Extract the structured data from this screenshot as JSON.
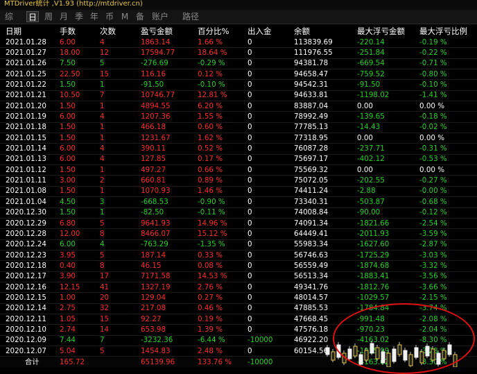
{
  "window": {
    "title": "MTDriver统计 ,V1.93 (http://mtdriver.cn)"
  },
  "tabs": [
    {
      "label": "综",
      "active": false
    },
    {
      "label": "日",
      "active": true
    },
    {
      "label": "周",
      "active": false
    },
    {
      "label": "月",
      "active": false
    },
    {
      "label": "季",
      "active": false
    },
    {
      "label": "年",
      "active": false
    },
    {
      "label": "币",
      "active": false
    },
    {
      "label": "M",
      "active": false
    },
    {
      "label": "备",
      "active": false
    },
    {
      "label": "账户",
      "active": false
    },
    {
      "label": "路径",
      "active": false
    }
  ],
  "table": {
    "headers": [
      "日期",
      "手数",
      "次数",
      "盈亏金额",
      "百分比%",
      "出入金",
      "余额",
      "最大浮亏金额",
      "最大浮亏比例"
    ],
    "rows": [
      [
        "2021.01.28",
        "6.00",
        "4",
        "1863.14",
        "1.66 %",
        "0",
        "113839.69",
        "-220.14",
        "-0.19 %"
      ],
      [
        "2021.01.27",
        "18.00",
        "12",
        "17594.77",
        "18.64 %",
        "0",
        "111976.55",
        "-251.84",
        "-0.22 %"
      ],
      [
        "2021.01.26",
        "7.50",
        "5",
        "-276.69",
        "-0.29 %",
        "0",
        "94381.78",
        "-669.54",
        "-0.71 %"
      ],
      [
        "2021.01.25",
        "22.50",
        "15",
        "116.16",
        "0.12 %",
        "0",
        "94658.47",
        "-759.52",
        "-0.80 %"
      ],
      [
        "2021.01.22",
        "1.50",
        "1",
        "-91.50",
        "-0.10 %",
        "0",
        "94542.31",
        "-91.50",
        "-0.10 %"
      ],
      [
        "2021.01.21",
        "10.50",
        "7",
        "10746.77",
        "12.81 %",
        "0",
        "94633.81",
        "-1198.02",
        "-1.41 %"
      ],
      [
        "2021.01.20",
        "1.50",
        "1",
        "4894.55",
        "6.20 %",
        "0",
        "83887.04",
        "0.00",
        "0.00 %"
      ],
      [
        "2021.01.19",
        "6.00",
        "4",
        "1207.36",
        "1.55 %",
        "0",
        "78992.49",
        "-139.65",
        "-0.18 %"
      ],
      [
        "2021.01.18",
        "1.50",
        "1",
        "466.18",
        "0.60 %",
        "0",
        "77785.13",
        "-14.43",
        "-0.02 %"
      ],
      [
        "2021.01.15",
        "1.50",
        "1",
        "1231.67",
        "1.62 %",
        "0",
        "77318.95",
        "0.00",
        "0.00 %"
      ],
      [
        "2021.01.14",
        "6.00",
        "4",
        "390.11",
        "0.52 %",
        "0",
        "76087.28",
        "-237.71",
        "-0.31 %"
      ],
      [
        "2021.01.13",
        "6.00",
        "4",
        "127.85",
        "0.17 %",
        "0",
        "75697.17",
        "-402.12",
        "-0.53 %"
      ],
      [
        "2021.01.12",
        "1.50",
        "1",
        "497.27",
        "0.66 %",
        "0",
        "75569.32",
        "0.00",
        "0.00 %"
      ],
      [
        "2021.01.11",
        "3.00",
        "2",
        "660.81",
        "0.89 %",
        "0",
        "75072.05",
        "-202.55",
        "-0.27 %"
      ],
      [
        "2021.01.08",
        "1.50",
        "1",
        "1070.93",
        "1.46 %",
        "0",
        "74411.24",
        "-2.88",
        "-0.00 %"
      ],
      [
        "2021.01.04",
        "4.50",
        "3",
        "-668.53",
        "-0.90 %",
        "0",
        "73340.31",
        "-503.87",
        "-0.68 %"
      ],
      [
        "2020.12.30",
        "1.50",
        "1",
        "-82.50",
        "-0.11 %",
        "0",
        "74008.84",
        "-90.00",
        "-0.12 %"
      ],
      [
        "2020.12.29",
        "6.80",
        "5",
        "9641.93",
        "14.96 %",
        "0",
        "74091.34",
        "-1821.66",
        "-2.54 %"
      ],
      [
        "2020.12.28",
        "12.00",
        "8",
        "8466.07",
        "15.12 %",
        "0",
        "64449.41",
        "-2011.93",
        "-3.59 %"
      ],
      [
        "2020.12.24",
        "6.00",
        "4",
        "-763.29",
        "-1.35 %",
        "0",
        "55983.34",
        "-1627.60",
        "-2.87 %"
      ],
      [
        "2020.12.23",
        "3.95",
        "5",
        "187.14",
        "0.33 %",
        "0",
        "56746.63",
        "-1725.29",
        "-3.03 %"
      ],
      [
        "2020.12.18",
        "0.40",
        "8",
        "46.15",
        "0.08 %",
        "0",
        "56559.49",
        "-1874.68",
        "-3.32 %"
      ],
      [
        "2020.12.17",
        "3.90",
        "17",
        "7171.58",
        "14.53 %",
        "0",
        "56513.34",
        "-1883.41",
        "-3.56 %"
      ],
      [
        "2020.12.16",
        "12.15",
        "41",
        "1327.19",
        "2.76 %",
        "0",
        "49341.76",
        "-1812.76",
        "-3.66 %"
      ],
      [
        "2020.12.15",
        "1.00",
        "20",
        "129.04",
        "0.27 %",
        "0",
        "48014.57",
        "-1029.57",
        "-2.15 %"
      ],
      [
        "2020.12.14",
        "2.75",
        "32",
        "217.08",
        "0.46 %",
        "0",
        "47885.53",
        "-1784.84",
        "-3.74 %"
      ],
      [
        "2020.12.11",
        "1.05",
        "15",
        "92.27",
        "0.19 %",
        "0",
        "47668.45",
        "-991.48",
        "-2.08 %"
      ],
      [
        "2020.12.10",
        "2.74",
        "14",
        "653.98",
        "1.39 %",
        "0",
        "47576.18",
        "-970.23",
        "-2.04 %"
      ],
      [
        "2020.12.09",
        "7.44",
        "7",
        "-3232.36",
        "-6.44 %",
        "-10000",
        "46922.20",
        "-4163.02",
        "-8.30 %"
      ],
      [
        "2020.12.07",
        "5.04",
        "5",
        "1454.83",
        "2.48 %",
        "0",
        "60154.56",
        "-1925.99",
        "-3.28 %"
      ]
    ],
    "total": {
      "label": "合计",
      "lots": "165.72",
      "count": "",
      "pnl": "65139.96",
      "pct": "133.76 %",
      "flow": "-10000",
      "balance": "",
      "maxdd": "-4163.02",
      "maxddpct": "-8.30 %"
    }
  },
  "colors": {
    "profit": "#ff2a2a",
    "loss": "#21d421",
    "neutral": "#ffffff",
    "highlight_circle": "#e01010"
  }
}
